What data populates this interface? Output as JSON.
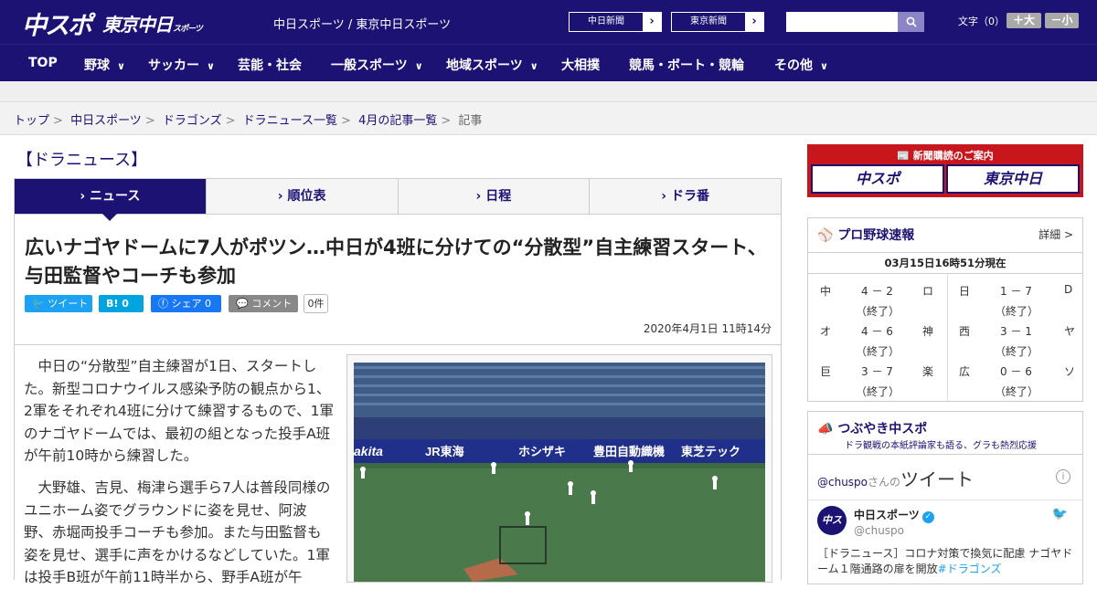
{
  "header": {
    "logo_chuspo": "中スポ",
    "logo_tokyo": "東京中日",
    "logo_tokyo_sub": "スポーツ",
    "site_name": "中日スポーツ / 東京中日スポーツ",
    "paper_buttons": [
      "中日新聞",
      "東京新聞"
    ],
    "font_label": "文字（0）",
    "font_bigger": "＋大",
    "font_smaller": "－小",
    "search_icon": "search-icon"
  },
  "nav": {
    "items": [
      {
        "label": "TOP",
        "has_menu": false
      },
      {
        "label": "野球",
        "has_menu": true
      },
      {
        "label": "サッカー",
        "has_menu": true
      },
      {
        "label": "芸能・社会",
        "has_menu": false
      },
      {
        "label": "一般スポーツ",
        "has_menu": true
      },
      {
        "label": "地域スポーツ",
        "has_menu": true
      },
      {
        "label": "大相撲",
        "has_menu": false
      },
      {
        "label": "競馬・ボート・競輪",
        "has_menu": false
      },
      {
        "label": "その他",
        "has_menu": true
      }
    ],
    "chevron": "⌄"
  },
  "breadcrumb": {
    "links": [
      "トップ",
      "中日スポーツ",
      "ドラゴンズ",
      "ドラニュース一覧",
      "4月の記事一覧"
    ],
    "current": "記事",
    "sep": ">"
  },
  "section_title": "【ドラニュース】",
  "tabs": [
    {
      "label": "ニュース",
      "active": true
    },
    {
      "label": "順位表",
      "active": false
    },
    {
      "label": "日程",
      "active": false
    },
    {
      "label": "ドラ番",
      "active": false
    }
  ],
  "article": {
    "headline": "広いナゴヤドームに7人がポツン…中日が4班に分けての“分散型”自主練習スタート、与田監督やコーチも参加",
    "share": {
      "tweet": "ツイート",
      "hatena": "B! 0",
      "facebook": "シェア 0",
      "comment": "コメント",
      "comment_count": "0件"
    },
    "date": "2020年4月1日 11時14分",
    "para1": "中日の“分散型”自主練習が1日、スタートした。新型コロナウイルス感染予防の観点から1、2軍をそれぞれ4班に分けて練習するもので、1軍のナゴヤドームでは、最初の組となった投手A班が午前10時から練習した。",
    "para2": "大野雄、吉見、梅津ら選手ら7人は普段同様のユニホーム姿でグラウンドに姿を見せ、阿波野、赤堀両投手コーチも参加。また与田監督も姿を見せ、選手に声をかけるなどしていた。1軍は投手B班が午前11時半から、野手A班が午",
    "photo_ads": [
      "akita",
      "JR東海",
      "ホシザキ",
      "豊田自動織機",
      "東芝テック"
    ]
  },
  "sidebar": {
    "promo": {
      "title": "新聞購読のご案内",
      "left": "中スポ",
      "right": "東京中日"
    },
    "scores": {
      "title": "プロ野球速報",
      "detail": "詳細 >",
      "as_of": "03月15日16時51分現在",
      "games": [
        {
          "home": "中",
          "score": "4 － 2",
          "away": "ロ",
          "status": "（終了）"
        },
        {
          "home": "日",
          "score": "1 － 7",
          "away": "D",
          "status": "（終了）"
        },
        {
          "home": "オ",
          "score": "4 － 6",
          "away": "神",
          "status": "（終了）"
        },
        {
          "home": "西",
          "score": "3 － 1",
          "away": "ヤ",
          "status": "（終了）"
        },
        {
          "home": "巨",
          "score": "3 － 7",
          "away": "楽",
          "status": "（終了）"
        },
        {
          "home": "広",
          "score": "0 － 6",
          "away": "ソ",
          "status": "（終了）"
        }
      ]
    },
    "twitter": {
      "title": "つぶやき中スポ",
      "subtitle": "ドラ観戦の本紙評論家も語る、グラも熱烈応援",
      "handle_link": "@chuspo",
      "handle_suffix": "さんの",
      "handle_big": "ツイート",
      "user_name": "中日スポーツ",
      "user_handle": "@chuspo",
      "avatar_text": "中スポ",
      "tweet_text": "［ドラニュース］コロナ対策で換気に配慮 ナゴヤドーム１階通路の扉を開放",
      "tweet_hashtag": "#ドラゴンズ"
    }
  },
  "colors": {
    "brand_navy": "#1c1273",
    "promo_red": "#c8161d",
    "twitter_blue": "#1da1f2",
    "facebook_blue": "#1877f2",
    "hatena_blue": "#00a4de",
    "comment_gray": "#888888"
  }
}
